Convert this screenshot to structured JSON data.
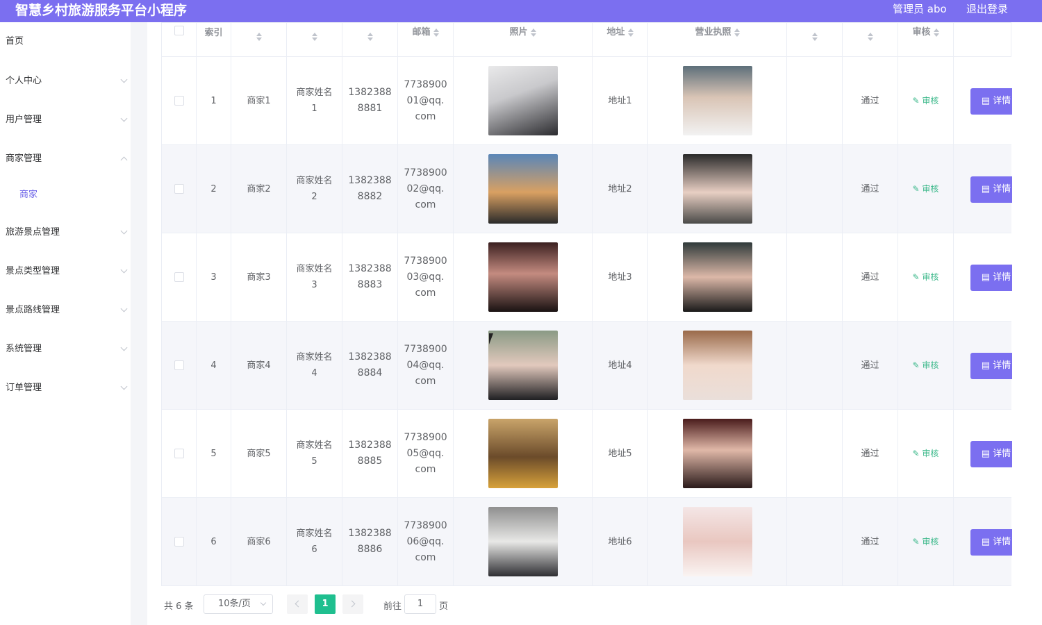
{
  "app": {
    "title": "智慧乡村旅游服务平台小程序",
    "admin_label": "管理员 abo",
    "logout_label": "退出登录"
  },
  "sidebar": {
    "items": [
      {
        "label": "首页",
        "expanded": false
      },
      {
        "label": "个人中心",
        "expanded": false
      },
      {
        "label": "用户管理",
        "expanded": false
      },
      {
        "label": "商家管理",
        "expanded": true
      },
      {
        "label": "旅游景点管理",
        "expanded": false
      },
      {
        "label": "景点类型管理",
        "expanded": false
      },
      {
        "label": "景点路线管理",
        "expanded": false
      },
      {
        "label": "系统管理",
        "expanded": false
      },
      {
        "label": "订单管理",
        "expanded": false
      }
    ],
    "active_sub": "商家"
  },
  "table": {
    "headers": {
      "index": "索引",
      "email": "邮箱",
      "photo": "照片",
      "address": "地址",
      "license": "营业执照",
      "audit": "审核"
    },
    "rows": [
      {
        "index": "1",
        "name": "商家1",
        "owner": "商家姓名\n1",
        "phone": "1382388\n8881",
        "email": "7738900\n01@qq.\ncom",
        "address": "地址1",
        "status": "通过",
        "audit": "审核",
        "detail": "详情"
      },
      {
        "index": "2",
        "name": "商家2",
        "owner": "商家姓名\n2",
        "phone": "1382388\n8882",
        "email": "7738900\n02@qq.\ncom",
        "address": "地址2",
        "status": "通过",
        "audit": "审核",
        "detail": "详情"
      },
      {
        "index": "3",
        "name": "商家3",
        "owner": "商家姓名\n3",
        "phone": "1382388\n8883",
        "email": "7738900\n03@qq.\ncom",
        "address": "地址3",
        "status": "通过",
        "audit": "审核",
        "detail": "详情"
      },
      {
        "index": "4",
        "name": "商家4",
        "owner": "商家姓名\n4",
        "phone": "1382388\n8884",
        "email": "7738900\n04@qq.\ncom",
        "address": "地址4",
        "status": "通过",
        "audit": "审核",
        "detail": "详情"
      },
      {
        "index": "5",
        "name": "商家5",
        "owner": "商家姓名\n5",
        "phone": "1382388\n8885",
        "email": "7738900\n05@qq.\ncom",
        "address": "地址5",
        "status": "通过",
        "audit": "审核",
        "detail": "详情"
      },
      {
        "index": "6",
        "name": "商家6",
        "owner": "商家姓名\n6",
        "phone": "1382388\n8886",
        "email": "7738900\n06@qq.\ncom",
        "address": "地址6",
        "status": "通过",
        "audit": "审核",
        "detail": "详情"
      }
    ]
  },
  "pagination": {
    "total_label": "共 6 条",
    "page_size": "10条/页",
    "current_page": "1",
    "goto_label": "前往",
    "goto_value": "1",
    "page_suffix": "页"
  },
  "colors": {
    "accent": "#7b6ff0",
    "success": "#3bb88a",
    "page_active": "#1fbf8f"
  }
}
